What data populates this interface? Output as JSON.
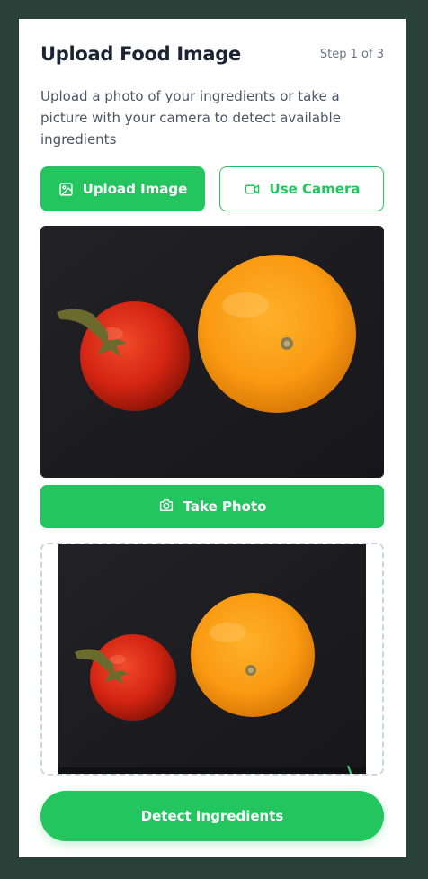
{
  "header": {
    "title": "Upload Food Image",
    "step": "Step 1 of 3"
  },
  "description": "Upload a photo of your ingredients or take a picture with your camera to detect available ingredients",
  "actions": {
    "upload_label": "Upload Image",
    "camera_label": "Use Camera",
    "take_photo_label": "Take Photo",
    "detect_label": "Detect Ingredients"
  },
  "icons": {
    "upload": "image-icon",
    "camera": "video-camera-icon",
    "take_photo": "camera-icon"
  },
  "images": {
    "preview": "tomato and orange on dark background",
    "captured": "tomato and orange on dark background"
  },
  "colors": {
    "accent": "#22c55e",
    "background": "#2a413a",
    "card": "#ffffff",
    "title": "#1c2434"
  }
}
